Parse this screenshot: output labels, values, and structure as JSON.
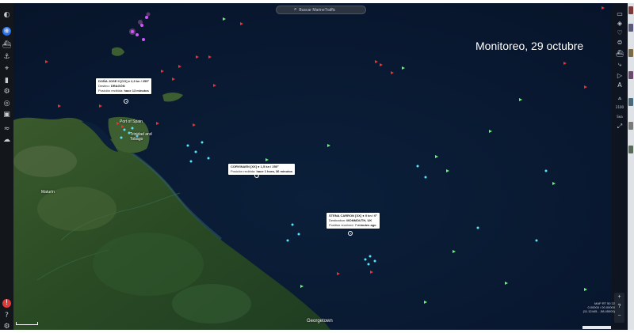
{
  "search": {
    "placeholder": "Buscar MarineTraffic"
  },
  "overlay_title": "Monitoreo, 29 octubre",
  "popups": [
    {
      "title": "DOÑA JOSE II [CO] ● 2,9 kn / 255°",
      "line2_label": "Destino:",
      "line2_value": "DRAGÓN",
      "line3_label": "Posición recibida:",
      "line3_value": "hace 13 minutos"
    },
    {
      "title": "CORVINAEN [XX] ● 1,5 kn / 250°",
      "line2_label": "Posición recibida:",
      "line2_value": "hace 1 hora, 36 minutos"
    },
    {
      "title": "STENA CARRON [XX] ● 0 kn / 0°",
      "line2_label": "Destination:",
      "line2_value": "MONMOUTH, UK",
      "line3_label": "Position received:",
      "line3_value": "7 minutes ago"
    }
  ],
  "place_labels": [
    "Trinidad and Tobago",
    "Port of Spain",
    "Maturín",
    "Georgetown"
  ],
  "coordinates": {
    "line1": "MAP RT 50 22",
    "line2": "0.00000 / 00.00000",
    "line3": "(11.12445 , -58.45000)"
  },
  "zoom": {
    "in": "+",
    "out": "−",
    "indicator": "?"
  },
  "right_rail": {
    "zoom_level": "2100",
    "mode_label": "Sea"
  },
  "icons": {
    "left_rail": [
      "theme-toggle-icon",
      "layers-icon",
      "ship-filter-icon",
      "anchor-icon",
      "port-icon",
      "chart-icon",
      "car-icon",
      "eye-icon",
      "news-icon",
      "fleet-icon",
      "weather-icon",
      "alert-icon",
      "help-icon",
      "settings-icon"
    ],
    "right_rail": [
      "fullscreen-icon",
      "layers-icon",
      "favorite-icon",
      "filter-icon",
      "vessel-icon",
      "route-icon",
      "play-icon",
      "measure-icon",
      "compass-icon"
    ]
  },
  "colors": {
    "ocean": "#0a1a30",
    "land": "#1f3d22",
    "ship_red": "#ff2a2a",
    "ship_green": "#5cff6a",
    "ship_cyan": "#58e6ff",
    "ship_magenta": "#d455ff"
  }
}
